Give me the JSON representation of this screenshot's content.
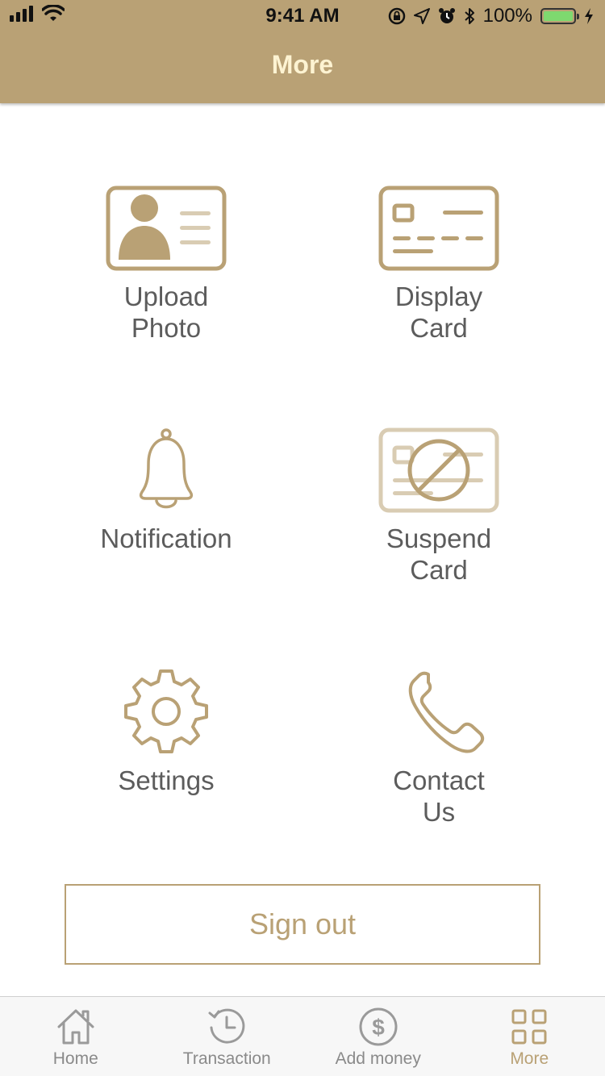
{
  "status_bar": {
    "time": "9:41 AM",
    "battery_percent": "100%",
    "battery_level": 1.0
  },
  "nav": {
    "title": "More"
  },
  "menu": {
    "items": [
      {
        "label": "Upload\nPhoto",
        "icon": "id-card-photo-icon"
      },
      {
        "label": "Display\nCard",
        "icon": "card-icon"
      },
      {
        "label": "Notification",
        "icon": "bell-icon"
      },
      {
        "label": "Suspend\nCard",
        "icon": "suspend-card-icon"
      },
      {
        "label": "Settings",
        "icon": "gear-icon"
      },
      {
        "label": "Contact\nUs",
        "icon": "phone-icon"
      }
    ]
  },
  "signout": {
    "label": "Sign out"
  },
  "tabbar": {
    "items": [
      {
        "label": "Home",
        "icon": "home-icon",
        "active": false
      },
      {
        "label": "Transaction",
        "icon": "history-icon",
        "active": false
      },
      {
        "label": "Add money",
        "icon": "dollar-icon",
        "active": false
      },
      {
        "label": "More",
        "icon": "grid-icon",
        "active": true
      }
    ]
  },
  "colors": {
    "accent": "#b9a175",
    "title_text": "#fdf3d2",
    "label_text": "#5c5c5c",
    "tab_inactive": "#8a8a8a"
  }
}
